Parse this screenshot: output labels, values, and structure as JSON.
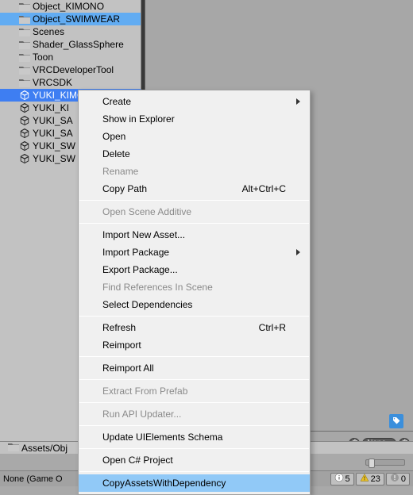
{
  "tree": {
    "items": [
      {
        "label": "Object_KIMONO",
        "icon": "folder",
        "sel": false,
        "depth": 1
      },
      {
        "label": "Object_SWIMWEAR",
        "icon": "folder",
        "sel": false,
        "depth": 1,
        "hi": true
      },
      {
        "label": "Scenes",
        "icon": "folder",
        "sel": false,
        "depth": 1
      },
      {
        "label": "Shader_GlassSphere",
        "icon": "folder",
        "sel": false,
        "depth": 1
      },
      {
        "label": "Toon",
        "icon": "folder",
        "sel": false,
        "depth": 1
      },
      {
        "label": "VRCDeveloperTool",
        "icon": "folder",
        "sel": false,
        "depth": 1
      },
      {
        "label": "VRCSDK",
        "icon": "folder",
        "sel": false,
        "depth": 1
      },
      {
        "label": "YUKI_KIMONO",
        "icon": "unity",
        "sel": true,
        "depth": 1
      },
      {
        "label": "YUKI_KI",
        "icon": "unity",
        "sel": false,
        "depth": 1,
        "trunc": true
      },
      {
        "label": "YUKI_SA",
        "icon": "unity",
        "sel": false,
        "depth": 1,
        "trunc": true
      },
      {
        "label": "YUKI_SA",
        "icon": "unity",
        "sel": false,
        "depth": 1,
        "trunc": true
      },
      {
        "label": "YUKI_SW",
        "icon": "unity",
        "sel": false,
        "depth": 1,
        "trunc": true
      },
      {
        "label": "YUKI_SW",
        "icon": "unity",
        "sel": false,
        "depth": 1,
        "trunc": true
      }
    ]
  },
  "breadcrumb": {
    "text": "Assets/Obj"
  },
  "dropdowns": {
    "a": "None",
    "b": ""
  },
  "status": {
    "left": "None (Game O",
    "pills": [
      {
        "icon": "info",
        "n": "5"
      },
      {
        "icon": "warn",
        "n": "23"
      },
      {
        "icon": "err",
        "n": "0"
      }
    ]
  },
  "ctx": {
    "items": [
      {
        "label": "Create",
        "sub": true
      },
      {
        "label": "Show in Explorer"
      },
      {
        "label": "Open"
      },
      {
        "label": "Delete"
      },
      {
        "label": "Rename",
        "disabled": true
      },
      {
        "label": "Copy Path",
        "shortcut": "Alt+Ctrl+C"
      },
      {
        "sep": true
      },
      {
        "label": "Open Scene Additive",
        "disabled": true
      },
      {
        "sep": true
      },
      {
        "label": "Import New Asset..."
      },
      {
        "label": "Import Package",
        "sub": true
      },
      {
        "label": "Export Package..."
      },
      {
        "label": "Find References In Scene",
        "disabled": true
      },
      {
        "label": "Select Dependencies"
      },
      {
        "sep": true
      },
      {
        "label": "Refresh",
        "shortcut": "Ctrl+R"
      },
      {
        "label": "Reimport"
      },
      {
        "sep": true
      },
      {
        "label": "Reimport All"
      },
      {
        "sep": true
      },
      {
        "label": "Extract From Prefab",
        "disabled": true
      },
      {
        "sep": true
      },
      {
        "label": "Run API Updater...",
        "disabled": true
      },
      {
        "sep": true
      },
      {
        "label": "Update UIElements Schema"
      },
      {
        "sep": true
      },
      {
        "label": "Open C# Project"
      },
      {
        "sep": true
      },
      {
        "label": "CopyAssetsWithDependency",
        "hover": true
      }
    ]
  }
}
